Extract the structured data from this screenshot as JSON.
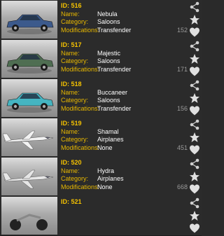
{
  "labels": {
    "name": "Name:",
    "category": "Category:",
    "modifications": "Modifications:"
  },
  "items": [
    {
      "id": "ID: 516",
      "name": "Nebula",
      "category": "Saloons",
      "modifications": "Transfender",
      "count": "152",
      "thumb": "car-icon",
      "car_color": "#3c5a8c"
    },
    {
      "id": "ID: 517",
      "name": "Majestic",
      "category": "Saloons",
      "modifications": "Transfender",
      "count": "171",
      "thumb": "car-icon",
      "car_color": "#4f6e52"
    },
    {
      "id": "ID: 518",
      "name": "Buccaneer",
      "category": "Saloons",
      "modifications": "Transfender",
      "count": "156",
      "thumb": "car-icon",
      "car_color": "#45b5c2"
    },
    {
      "id": "ID: 519",
      "name": "Shamal",
      "category": "Airplanes",
      "modifications": "None",
      "count": "451",
      "thumb": "jet-icon",
      "car_color": "#f2f2f2"
    },
    {
      "id": "ID: 520",
      "name": "Hydra",
      "category": "Airplanes",
      "modifications": "None",
      "count": "668",
      "thumb": "jet-icon",
      "car_color": "#e6e6e6"
    },
    {
      "id": "ID: 521",
      "name": "",
      "category": "",
      "modifications": "",
      "count": "",
      "thumb": "motorbike-icon",
      "car_color": "#bbbbbb"
    }
  ]
}
